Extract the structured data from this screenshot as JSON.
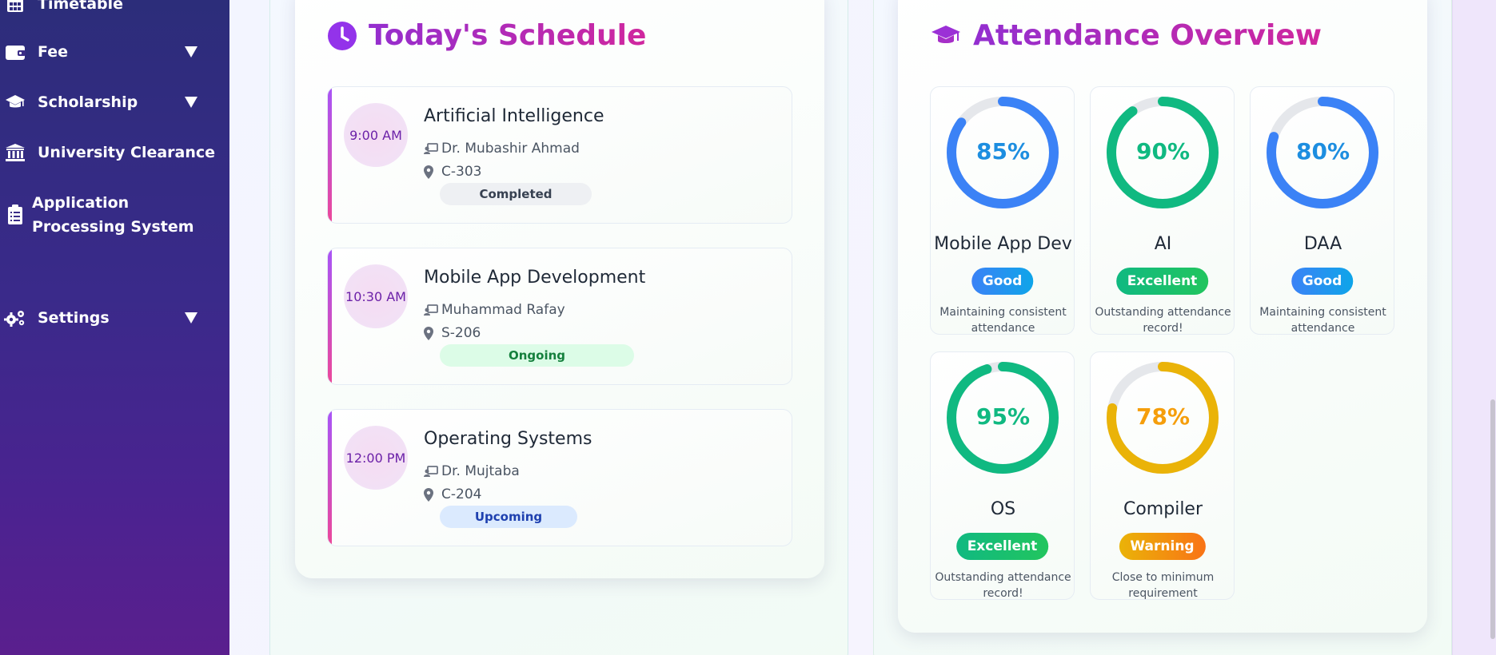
{
  "sidebar": {
    "items": [
      {
        "label": "Timetable",
        "icon": "table-icon",
        "has_caret": false
      },
      {
        "label": "Fee",
        "icon": "wallet-icon",
        "has_caret": true
      },
      {
        "label": "Scholarship",
        "icon": "graduation-cap-icon",
        "has_caret": true
      },
      {
        "label": "University Clearance",
        "icon": "university-icon",
        "has_caret": false
      },
      {
        "label_line1": "Application",
        "label_line2": "Processing System",
        "icon": "clipboard-icon",
        "has_caret": false
      },
      {
        "label": "Settings",
        "icon": "gears-icon",
        "has_caret": true
      }
    ]
  },
  "schedule": {
    "title": "Today's Schedule",
    "icon": "clock-icon",
    "items": [
      {
        "time": "9:00 AM",
        "course": "Artificial Intelligence",
        "teacher": "Dr. Mubashir Ahmad",
        "room": "C-303",
        "status": "Completed"
      },
      {
        "time": "10:30 AM",
        "course": "Mobile App Development",
        "teacher": "Muhammad Rafay",
        "room": "S-206",
        "status": "Ongoing"
      },
      {
        "time": "12:00 PM",
        "course": "Operating Systems",
        "teacher": "Dr. Mujtaba",
        "room": "C-204",
        "status": "Upcoming"
      }
    ],
    "status_colors": {
      "Completed": {
        "bg": "#eef0f3",
        "fg": "#374151"
      },
      "Ongoing": {
        "bg": "#dcfce7",
        "fg": "#15803d"
      },
      "Upcoming": {
        "bg": "#dbeafe",
        "fg": "#1e40af"
      }
    }
  },
  "attendance": {
    "title": "Attendance Overview",
    "icon": "graduation-cap-icon",
    "items": [
      {
        "percent": 85,
        "percent_label": "85%",
        "subject": "Mobile App Dev",
        "status": "Good",
        "note": "Maintaining consistent attendance",
        "ring_color": "#3b82f6",
        "text_color": "#1d8ee0",
        "badge_bg": "linear-gradient(90deg,#3b82f6,#0ea5e9)"
      },
      {
        "percent": 90,
        "percent_label": "90%",
        "subject": "AI",
        "status": "Excellent",
        "note": "Outstanding attendance record!",
        "ring_color": "#10b981",
        "text_color": "#10b981",
        "badge_bg": "linear-gradient(90deg,#10b981,#22c55e)"
      },
      {
        "percent": 80,
        "percent_label": "80%",
        "subject": "DAA",
        "status": "Good",
        "note": "Maintaining consistent attendance",
        "ring_color": "#3b82f6",
        "text_color": "#1d8ee0",
        "badge_bg": "linear-gradient(90deg,#3b82f6,#0ea5e9)"
      },
      {
        "percent": 95,
        "percent_label": "95%",
        "subject": "OS",
        "status": "Excellent",
        "note": "Outstanding attendance record!",
        "ring_color": "#10b981",
        "text_color": "#10b981",
        "badge_bg": "linear-gradient(90deg,#10b981,#22c55e)"
      },
      {
        "percent": 78,
        "percent_label": "78%",
        "subject": "Compiler",
        "status": "Warning",
        "note": "Close to minimum requirement",
        "ring_color": "#eab308",
        "text_color": "#f59e0b",
        "badge_bg": "linear-gradient(90deg,#eab308,#f97316)"
      }
    ]
  }
}
